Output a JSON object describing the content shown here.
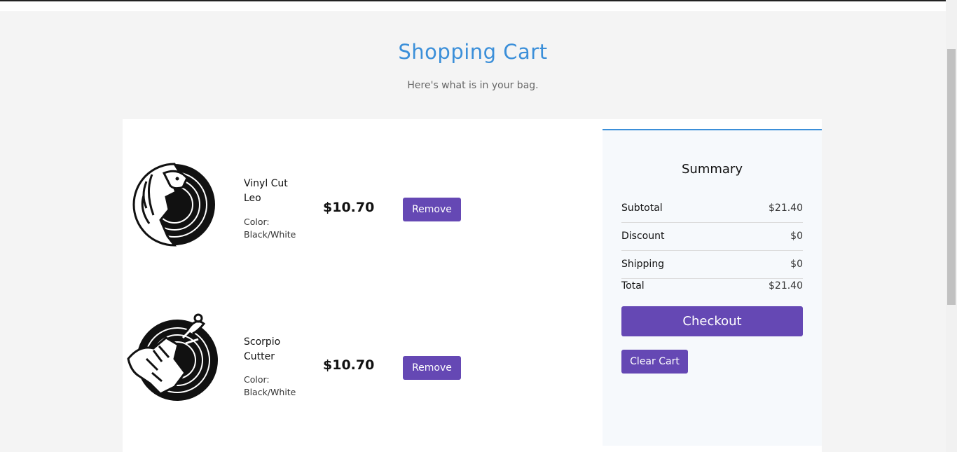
{
  "header": {
    "title": "Shopping Cart",
    "subtitle": "Here's what is in your bag."
  },
  "items": [
    {
      "name": "Vinyl Cut Leo",
      "color": "Color: Black/White",
      "price": "$10.70",
      "remove_label": "Remove",
      "image_icon": "lion-vinyl-icon"
    },
    {
      "name": "Scorpio Cutter",
      "color": "Color: Black/White",
      "price": "$10.70",
      "remove_label": "Remove",
      "image_icon": "scorpion-vinyl-icon"
    }
  ],
  "summary": {
    "title": "Summary",
    "subtotal_label": "Subtotal",
    "subtotal_value": "$21.40",
    "discount_label": "Discount",
    "discount_value": "$0",
    "shipping_label": "Shipping",
    "shipping_value": "$0",
    "total_label": "Total",
    "total_value": "$21.40",
    "checkout_label": "Checkout",
    "clear_label": "Clear Cart"
  },
  "colors": {
    "accent": "#6548b4",
    "title_blue": "#3b8fd9"
  }
}
